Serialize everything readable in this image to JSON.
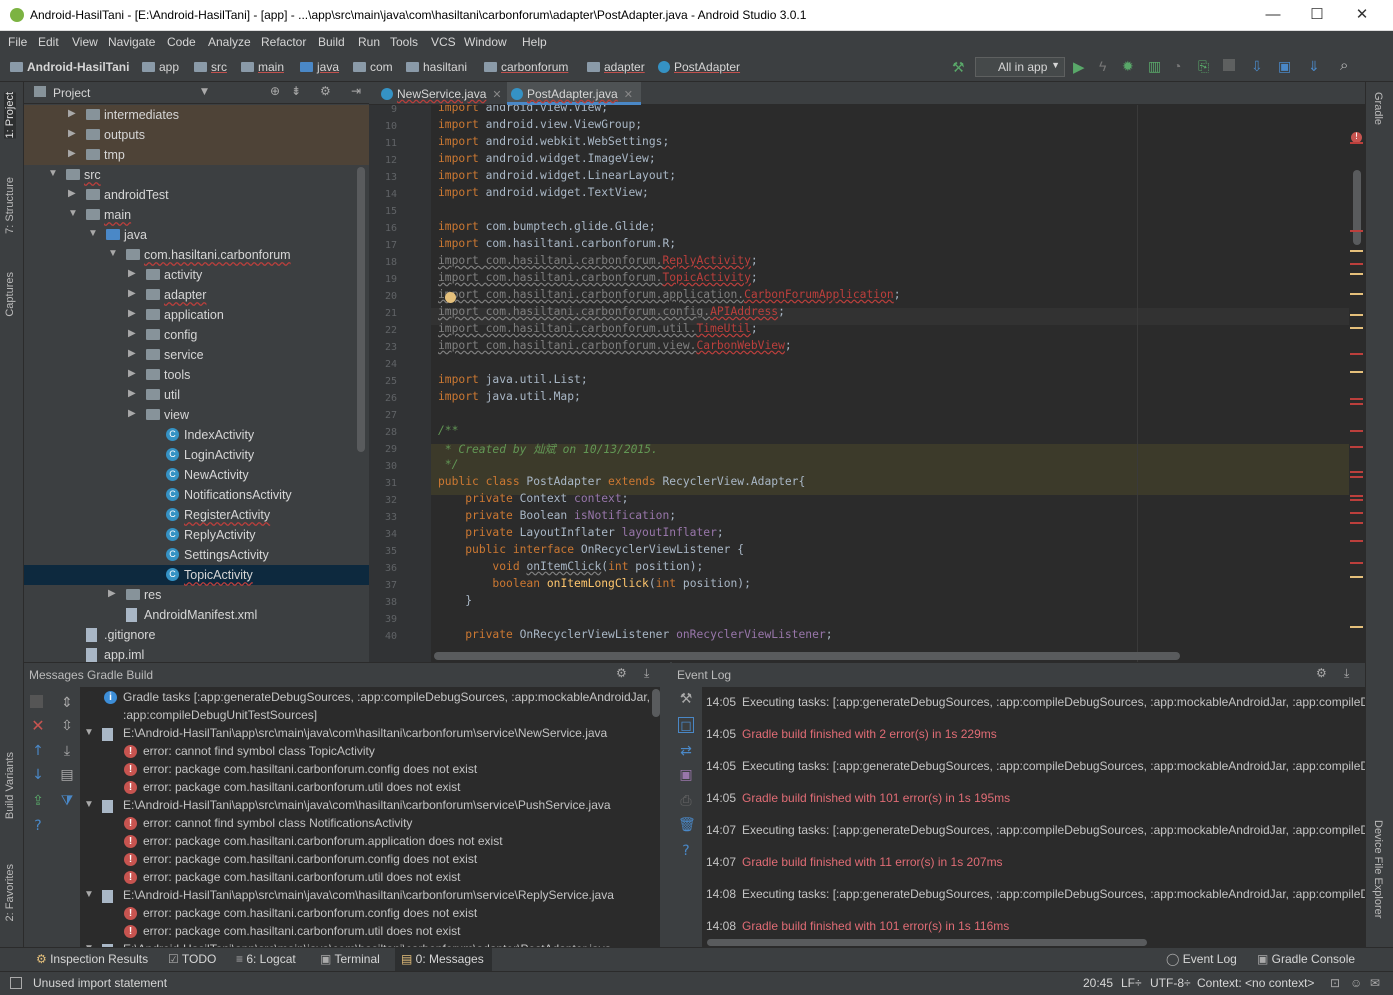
{
  "window": {
    "title": "Android-HasilTani - [E:\\Android-HasilTani] - [app] - ...\\app\\src\\main\\java\\com\\hasiltani\\carbonforum\\adapter\\PostAdapter.java - Android Studio 3.0.1"
  },
  "menu": [
    "File",
    "Edit",
    "View",
    "Navigate",
    "Code",
    "Analyze",
    "Refactor",
    "Build",
    "Run",
    "Tools",
    "VCS",
    "Window",
    "Help"
  ],
  "breadcrumbs": [
    "Android-HasilTani",
    "app",
    "src",
    "main",
    "java",
    "com",
    "hasiltani",
    "carbonforum",
    "adapter",
    "PostAdapter"
  ],
  "toolbar": {
    "run_config": "All in app"
  },
  "side_tabs": {
    "left": [
      "1: Project",
      "7: Structure",
      "Captures",
      "Build Variants",
      "2: Favorites"
    ],
    "right": [
      "Gradle",
      "Device File Explorer"
    ]
  },
  "project": {
    "title": "Project",
    "tree": [
      {
        "label": "intermediates",
        "kind": "folder",
        "depth": 2,
        "arrow": "right"
      },
      {
        "label": "outputs",
        "kind": "folder",
        "depth": 2,
        "arrow": "right"
      },
      {
        "label": "tmp",
        "kind": "folder",
        "depth": 2,
        "arrow": "right"
      },
      {
        "label": "src",
        "kind": "folder",
        "depth": 1,
        "arrow": "down"
      },
      {
        "label": "androidTest",
        "kind": "folder",
        "depth": 2,
        "arrow": "right"
      },
      {
        "label": "main",
        "kind": "folder",
        "depth": 2,
        "arrow": "down"
      },
      {
        "label": "java",
        "kind": "folder-blue",
        "depth": 3,
        "arrow": "down"
      },
      {
        "label": "com.hasiltani.carbonforum",
        "kind": "folder",
        "depth": 4,
        "arrow": "down"
      },
      {
        "label": "activity",
        "kind": "folder",
        "depth": 5,
        "arrow": "right"
      },
      {
        "label": "adapter",
        "kind": "folder",
        "depth": 5,
        "arrow": "right"
      },
      {
        "label": "application",
        "kind": "folder",
        "depth": 5,
        "arrow": "right"
      },
      {
        "label": "config",
        "kind": "folder",
        "depth": 5,
        "arrow": "right"
      },
      {
        "label": "service",
        "kind": "folder",
        "depth": 5,
        "arrow": "right"
      },
      {
        "label": "tools",
        "kind": "folder",
        "depth": 5,
        "arrow": "right"
      },
      {
        "label": "util",
        "kind": "folder",
        "depth": 5,
        "arrow": "right"
      },
      {
        "label": "view",
        "kind": "folder",
        "depth": 5,
        "arrow": "right"
      },
      {
        "label": "IndexActivity",
        "kind": "class",
        "depth": 6
      },
      {
        "label": "LoginActivity",
        "kind": "class",
        "depth": 6
      },
      {
        "label": "NewActivity",
        "kind": "class",
        "depth": 6
      },
      {
        "label": "NotificationsActivity",
        "kind": "class",
        "depth": 6
      },
      {
        "label": "RegisterActivity",
        "kind": "class",
        "depth": 6
      },
      {
        "label": "ReplyActivity",
        "kind": "class",
        "depth": 6
      },
      {
        "label": "SettingsActivity",
        "kind": "class",
        "depth": 6
      },
      {
        "label": "TopicActivity",
        "kind": "class",
        "depth": 6
      },
      {
        "label": "res",
        "kind": "folder",
        "depth": 4,
        "arrow": "right"
      },
      {
        "label": "AndroidManifest.xml",
        "kind": "file",
        "depth": 4
      },
      {
        "label": ".gitignore",
        "kind": "file",
        "depth": 2
      },
      {
        "label": "app.iml",
        "kind": "file",
        "depth": 2
      }
    ]
  },
  "editor_tabs": [
    {
      "label": "NewService.java",
      "active": false
    },
    {
      "label": "PostAdapter.java",
      "active": true
    }
  ],
  "code_lines": [
    {
      "n": "9",
      "html": "<span class=\"kw\">import</span> android.view.View;"
    },
    {
      "n": "10",
      "html": "<span class=\"kw\">import</span> android.view.ViewGroup;"
    },
    {
      "n": "11",
      "html": "<span class=\"kw\">import</span> android.webkit.WebSettings;"
    },
    {
      "n": "12",
      "html": "<span class=\"kw\">import</span> android.widget.ImageView;"
    },
    {
      "n": "13",
      "html": "<span class=\"kw\">import</span> android.widget.LinearLayout;"
    },
    {
      "n": "14",
      "html": "<span class=\"kw\">import</span> android.widget.TextView;"
    },
    {
      "n": "15",
      "html": ""
    },
    {
      "n": "16",
      "html": "<span class=\"kw\">import</span> com.bumptech.glide.Glide;"
    },
    {
      "n": "17",
      "html": "<span class=\"kw\">import</span> com.hasiltani.carbonforum.R;"
    },
    {
      "n": "18",
      "html": "<span class=\"gray\">import com.hasiltani.carbonforum.</span><span class=\"red\">ReplyActivity</span>;"
    },
    {
      "n": "19",
      "html": "<span class=\"gray\">import com.hasiltani.carbonforum.</span><span class=\"red\">TopicActivity</span>;"
    },
    {
      "n": "20",
      "html": "<span class=\"gray\">import com.hasiltani.carbonforum.application.</span><span class=\"red\">CarbonForumApplication</span>;"
    },
    {
      "n": "21",
      "html": "<span class=\"gray\">import com.hasiltani.carbonforum.config.</span><span class=\"red\">APIAddress</span>;"
    },
    {
      "n": "22",
      "html": "<span class=\"gray\">import com.hasiltani.carbonforum.util.</span><span class=\"red\">TimeUtil</span>;"
    },
    {
      "n": "23",
      "html": "<span class=\"gray\">import com.hasiltani.carbonforum.view.</span><span class=\"red\">CarbonWebView</span>;"
    },
    {
      "n": "24",
      "html": ""
    },
    {
      "n": "25",
      "html": "<span class=\"kw\">import</span> java.util.List;"
    },
    {
      "n": "26",
      "html": "<span class=\"kw\">import</span> java.util.Map;"
    },
    {
      "n": "27",
      "html": ""
    },
    {
      "n": "28",
      "html": "<span class=\"cm\">/**</span>"
    },
    {
      "n": "29",
      "html": "<span class=\"cm\"> * Created by 灿斌 on 10/13/2015.</span>"
    },
    {
      "n": "30",
      "html": "<span class=\"cm\"> */</span>"
    },
    {
      "n": "31",
      "html": "<span class=\"kw\">public class</span> PostAdapter <span class=\"kw\">extends</span> RecyclerView.Adapter{"
    },
    {
      "n": "32",
      "html": "    <span class=\"kw\">private</span> Context <span class=\"fld\">context</span>;"
    },
    {
      "n": "33",
      "html": "    <span class=\"kw\">private</span> Boolean <span class=\"fld\">isNotification</span>;"
    },
    {
      "n": "34",
      "html": "    <span class=\"kw\">private</span> LayoutInflater <span class=\"fld\">layoutInflater</span>;"
    },
    {
      "n": "35",
      "html": "    <span class=\"kw\">public interface</span> OnRecyclerViewListener {"
    },
    {
      "n": "36",
      "html": "        <span class=\"kw\">void</span> <span class=\"fnu\">onItemClick</span>(<span class=\"kw\">int</span> position);"
    },
    {
      "n": "37",
      "html": "        <span class=\"kw\">boolean</span> <span class=\"meth\">onItemLongClick</span>(<span class=\"kw\">int</span> position);"
    },
    {
      "n": "38",
      "html": "    }"
    },
    {
      "n": "39",
      "html": ""
    },
    {
      "n": "40",
      "html": "    <span class=\"kw\">private</span> OnRecyclerViewListener <span class=\"fld\">onRecyclerViewListener</span>;"
    }
  ],
  "messages": {
    "header": "Messages Gradle Build",
    "rows": [
      {
        "type": "info",
        "indent": 0,
        "text": "Gradle tasks [:app:generateDebugSources, :app:compileDebugSources, :app:mockableAndroidJar,"
      },
      {
        "type": "cont",
        "indent": 0,
        "text": ":app:compileDebugUnitTestSources]"
      },
      {
        "type": "path",
        "indent": 0,
        "text": "E:\\Android-HasilTani\\app\\src\\main\\java\\com\\hasiltani\\carbonforum\\service\\NewService.java"
      },
      {
        "type": "error",
        "indent": 1,
        "text": "error: cannot find symbol class TopicActivity"
      },
      {
        "type": "error",
        "indent": 1,
        "text": "error: package com.hasiltani.carbonforum.config does not exist"
      },
      {
        "type": "error",
        "indent": 1,
        "text": "error: package com.hasiltani.carbonforum.util does not exist"
      },
      {
        "type": "path",
        "indent": 0,
        "text": "E:\\Android-HasilTani\\app\\src\\main\\java\\com\\hasiltani\\carbonforum\\service\\PushService.java"
      },
      {
        "type": "error",
        "indent": 1,
        "text": "error: cannot find symbol class NotificationsActivity"
      },
      {
        "type": "error",
        "indent": 1,
        "text": "error: package com.hasiltani.carbonforum.application does not exist"
      },
      {
        "type": "error",
        "indent": 1,
        "text": "error: package com.hasiltani.carbonforum.config does not exist"
      },
      {
        "type": "error",
        "indent": 1,
        "text": "error: package com.hasiltani.carbonforum.util does not exist"
      },
      {
        "type": "path",
        "indent": 0,
        "text": "E:\\Android-HasilTani\\app\\src\\main\\java\\com\\hasiltani\\carbonforum\\service\\ReplyService.java"
      },
      {
        "type": "error",
        "indent": 1,
        "text": "error: package com.hasiltani.carbonforum.config does not exist"
      },
      {
        "type": "error",
        "indent": 1,
        "text": "error: package com.hasiltani.carbonforum.util does not exist"
      },
      {
        "type": "path",
        "indent": 0,
        "text": "E:\\Android-HasilTani\\app\\src\\main\\java\\com\\hasiltani\\carbonforum\\adapter\\PostAdapter.java"
      }
    ]
  },
  "event_log": {
    "header": "Event Log",
    "entries": [
      {
        "time": "14:05",
        "text": "Executing tasks: [:app:generateDebugSources, :app:compileDebugSources, :app:mockableAndroidJar, :app:compileDebugUnitTestSources]",
        "error": false
      },
      {
        "time": "14:05",
        "text": "Gradle build finished with 2 error(s) in 1s 229ms",
        "error": true
      },
      {
        "time": "14:05",
        "text": "Executing tasks: [:app:generateDebugSources, :app:compileDebugSources, :app:mockableAndroidJar, :app:compileDebugUnitTestSources]",
        "error": false
      },
      {
        "time": "14:05",
        "text": "Gradle build finished with 101 error(s) in 1s 195ms",
        "error": true
      },
      {
        "time": "14:07",
        "text": "Executing tasks: [:app:generateDebugSources, :app:compileDebugSources, :app:mockableAndroidJar, :app:compileDebugUnitTestSources]",
        "error": false
      },
      {
        "time": "14:07",
        "text": "Gradle build finished with 11 error(s) in 1s 207ms",
        "error": true
      },
      {
        "time": "14:08",
        "text": "Executing tasks: [:app:generateDebugSources, :app:compileDebugSources, :app:mockableAndroidJar, :app:compileDebugUnitTestSources]",
        "error": false
      },
      {
        "time": "14:08",
        "text": "Gradle build finished with 101 error(s) in 1s 116ms",
        "error": true
      }
    ]
  },
  "bottom_tabs": {
    "inspection": "Inspection Results",
    "todo": "TODO",
    "logcat": "6: Logcat",
    "terminal": "Terminal",
    "messages": "0: Messages",
    "event_log": "Event Log",
    "gradle_console": "Gradle Console"
  },
  "status": {
    "message": "Unused import statement",
    "position": "20:45",
    "line_sep": "LF÷",
    "encoding": "UTF-8÷",
    "context": "Context: <no context>"
  },
  "colors": {
    "accent": "#4a88c7",
    "error": "#c75450",
    "background": "#2b2b2b"
  }
}
